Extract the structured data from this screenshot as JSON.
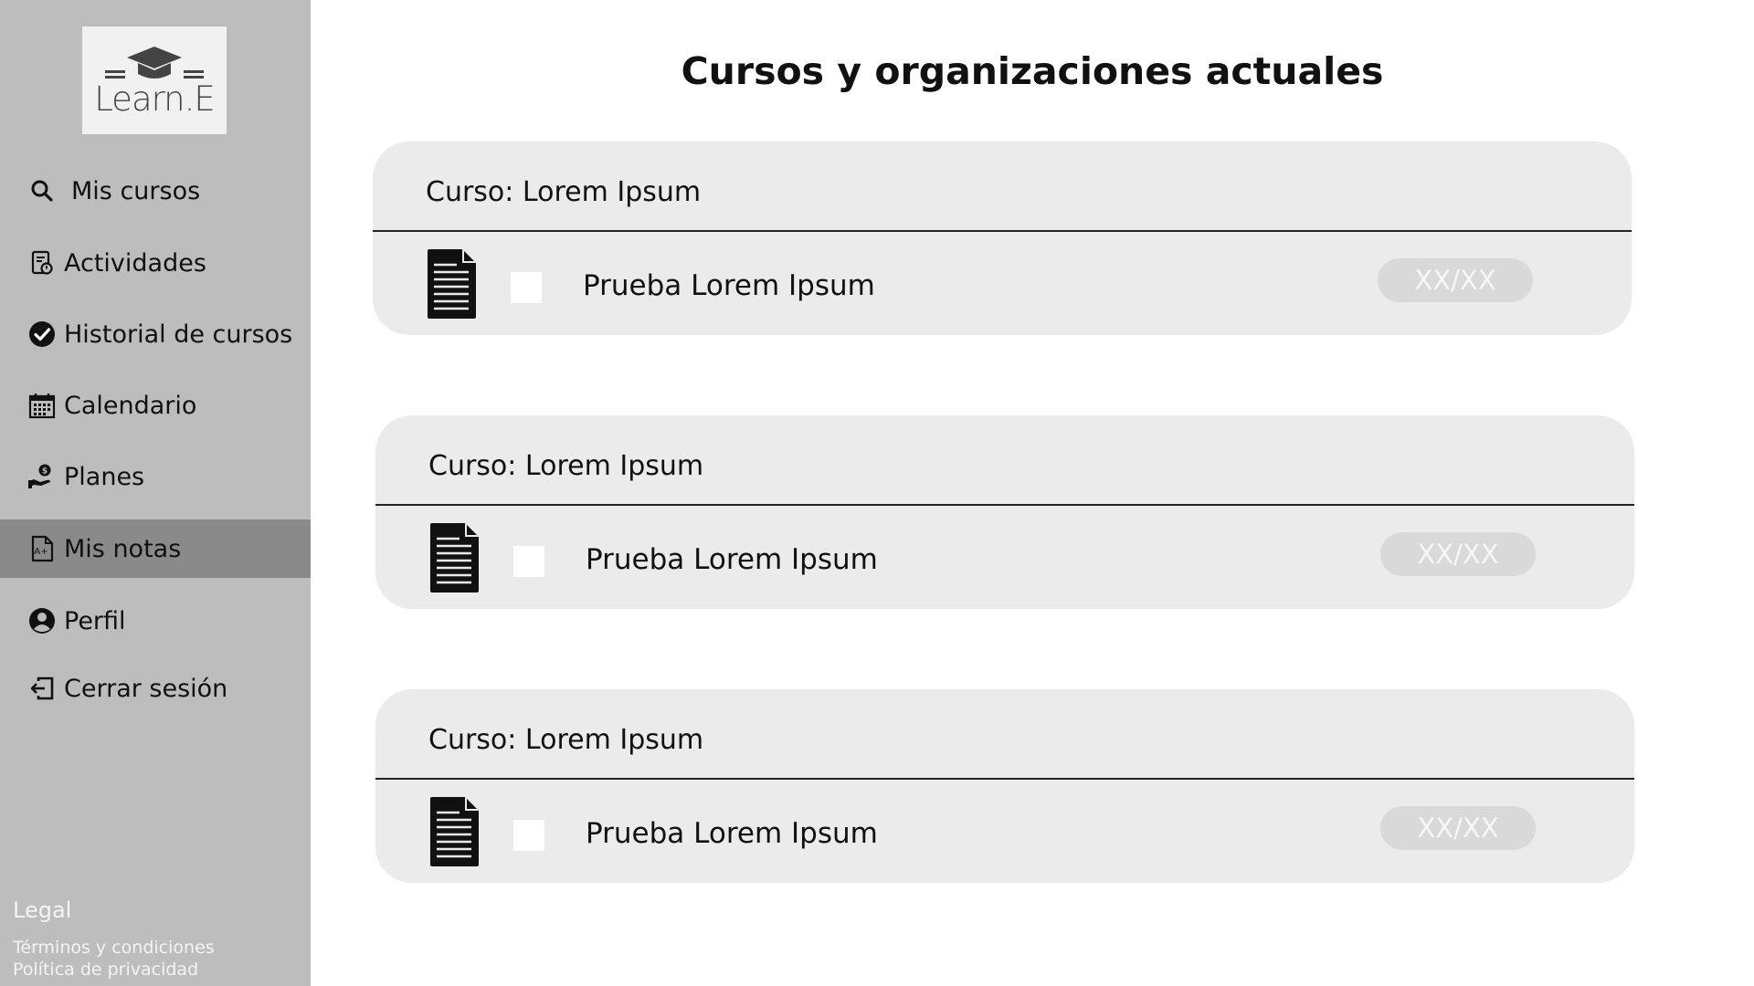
{
  "logo": {
    "text": "Learn.E"
  },
  "sidebar": {
    "items": [
      {
        "label": "Mis cursos",
        "icon": "search-icon"
      },
      {
        "label": "Actividades",
        "icon": "activities-icon"
      },
      {
        "label": "Historial de cursos",
        "icon": "check-circle-icon"
      },
      {
        "label": "Calendario",
        "icon": "calendar-icon"
      },
      {
        "label": "Planes",
        "icon": "hand-money-icon"
      },
      {
        "label": "Mis notas",
        "icon": "grade-document-icon",
        "active": true
      },
      {
        "label": "Perfil",
        "icon": "user-circle-icon"
      },
      {
        "label": "Cerrar sesión",
        "icon": "logout-icon"
      }
    ],
    "legal": {
      "heading": "Legal",
      "terms": "Términos y condiciones",
      "privacy": "Política de privacidad"
    }
  },
  "main": {
    "title": "Cursos y organizaciones actuales",
    "cards": [
      {
        "course": "Curso: Lorem Ipsum",
        "item": "Prueba Lorem Ipsum",
        "grade": "XX/XX"
      },
      {
        "course": "Curso: Lorem Ipsum",
        "item": "Prueba Lorem Ipsum",
        "grade": "XX/XX"
      },
      {
        "course": "Curso: Lorem Ipsum",
        "item": "Prueba Lorem Ipsum",
        "grade": "XX/XX"
      }
    ]
  },
  "colors": {
    "sidebar_bg": "#bdbdbd",
    "active_item_bg": "#8a8a8a",
    "card_bg": "#ebebeb",
    "grade_pill_bg": "#d9d9d9"
  }
}
